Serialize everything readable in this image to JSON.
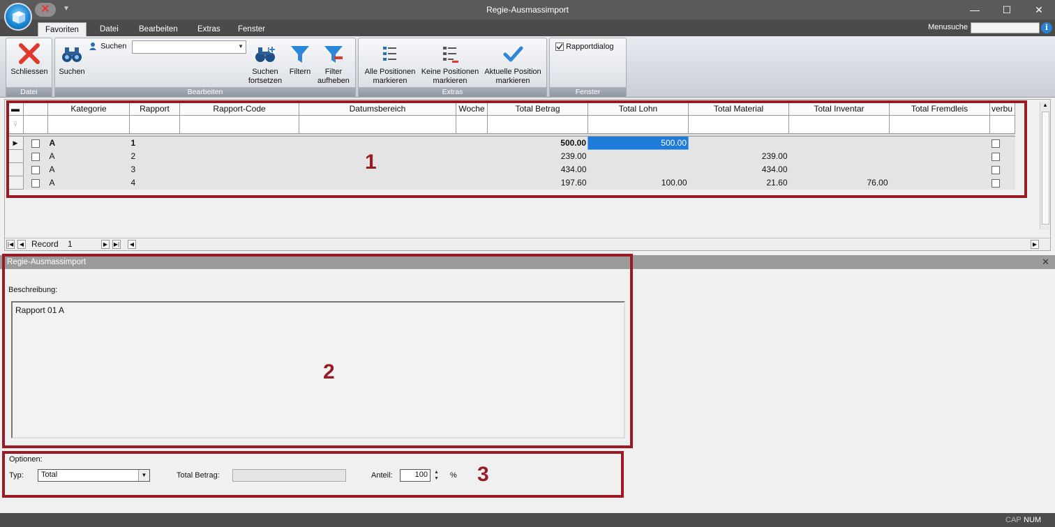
{
  "window": {
    "title": "Regie-Ausmassimport",
    "minimize": "—",
    "maximize": "☐",
    "close": "✕"
  },
  "tabs": [
    "Favoriten",
    "Datei",
    "Bearbeiten",
    "Extras",
    "Fenster"
  ],
  "menusuche": {
    "label": "Menusuche",
    "value": ""
  },
  "ribbon": {
    "datei": {
      "label": "Datei",
      "schliessen": "Schliessen"
    },
    "bearbeiten": {
      "label": "Bearbeiten",
      "suchen": "Suchen",
      "suchen_small": "Suchen",
      "suchen_fortsetzen": "Suchen fortsetzen",
      "filtern": "Filtern",
      "filter_aufheben": "Filter aufheben"
    },
    "extras": {
      "label": "Extras",
      "alle": "Alle Positionen markieren",
      "keine": "Keine Positionen markieren",
      "aktuelle": "Aktuelle Position markieren"
    },
    "fenster": {
      "label": "Fenster",
      "rapportdialog": "Rapportdialog"
    }
  },
  "grid": {
    "columns": [
      "Kategorie",
      "Rapport",
      "Rapport-Code",
      "Datumsbereich",
      "Woche",
      "Total Betrag",
      "Total Lohn",
      "Total Material",
      "Total Inventar",
      "Total Fremdleis",
      "verbu"
    ],
    "rows": [
      {
        "kategorie": "A",
        "rapport": "1",
        "betrag": "500.00",
        "lohn": "500.00",
        "material": "",
        "inventar": ""
      },
      {
        "kategorie": "A",
        "rapport": "2",
        "betrag": "239.00",
        "lohn": "",
        "material": "239.00",
        "inventar": ""
      },
      {
        "kategorie": "A",
        "rapport": "3",
        "betrag": "434.00",
        "lohn": "",
        "material": "434.00",
        "inventar": ""
      },
      {
        "kategorie": "A",
        "rapport": "4",
        "betrag": "197.60",
        "lohn": "100.00",
        "material": "21.60",
        "inventar": "76.00"
      }
    ],
    "record_label": "Record",
    "record_value": "1"
  },
  "detail": {
    "header": "Regie-Ausmassimport",
    "beschreibung_label": "Beschreibung:",
    "beschreibung_value": "Rapport 01 A",
    "optionen_label": "Optionen:",
    "typ_label": "Typ:",
    "typ_value": "Total",
    "total_betrag_label": "Total Betrag:",
    "anteil_label": "Anteil:",
    "anteil_value": "100",
    "percent": "%"
  },
  "annotations": [
    "1",
    "2",
    "3"
  ],
  "status": {
    "cap": "CAP",
    "num": "NUM"
  },
  "colors": {
    "annotation": "#9b1b24",
    "selection": "#1f7bd8"
  }
}
